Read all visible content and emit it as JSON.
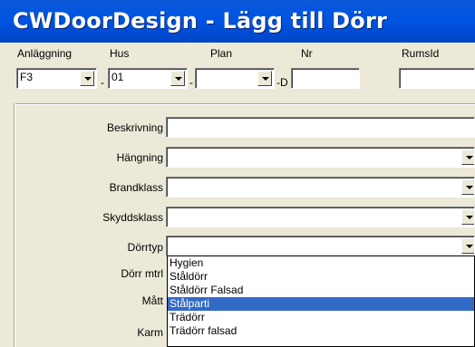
{
  "window": {
    "title": "CWDoorDesign - Lägg till Dörr"
  },
  "header": {
    "anlaggning_label": "Anläggning",
    "hus_label": "Hus",
    "plan_label": "Plan",
    "nr_label": "Nr",
    "rumsid_label": "RumsId",
    "anlaggning_value": "F3",
    "hus_value": "01",
    "plan_value": "",
    "nr_value": "",
    "rumsid_value": "",
    "sep_dash1": "-",
    "sep_dash2": "-",
    "sep_d": "-D"
  },
  "form": {
    "beskrivning_label": "Beskrivning",
    "hangning_label": "Hängning",
    "brandklass_label": "Brandklass",
    "skyddsklass_label": "Skyddsklass",
    "dorrtyp_label": "Dörrtyp",
    "dorr_mtrl_label": "Dörr mtrl",
    "matt_label": "Mått",
    "karm_label": "Karm"
  },
  "dropdown_list": {
    "items": [
      "Hygien",
      "Ståldörr",
      "Ståldörr Falsad",
      "Stålparti",
      "Trädörr",
      "Trädörr falsad"
    ],
    "selected": "Stålparti"
  }
}
